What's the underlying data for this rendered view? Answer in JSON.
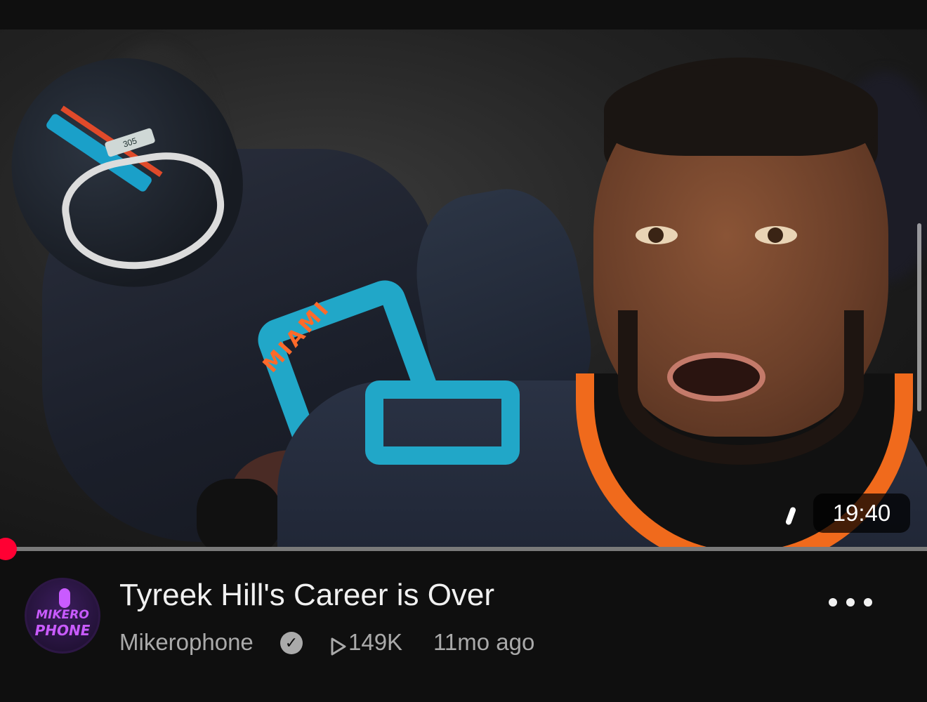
{
  "video": {
    "title": "Tyreek Hill's Career is Over",
    "duration": "19:40",
    "channel_name": "Mikerophone",
    "views": "149K",
    "age": "11mo ago",
    "progress": 0.0
  },
  "avatar": {
    "line1": "MIKERO",
    "line2": "PHONE"
  },
  "thumbnail": {
    "helmet_plate": "305",
    "jersey_text": "MIAMI"
  },
  "icons": {
    "verified": "verified-check-icon",
    "views": "play-triangle-icon",
    "more": "more-horizontal-icon"
  },
  "colors": {
    "background": "#0f0f0f",
    "progress": "#ff0000",
    "secondary_text": "#aaaaaa",
    "avatar_accent": "#c95bff"
  }
}
